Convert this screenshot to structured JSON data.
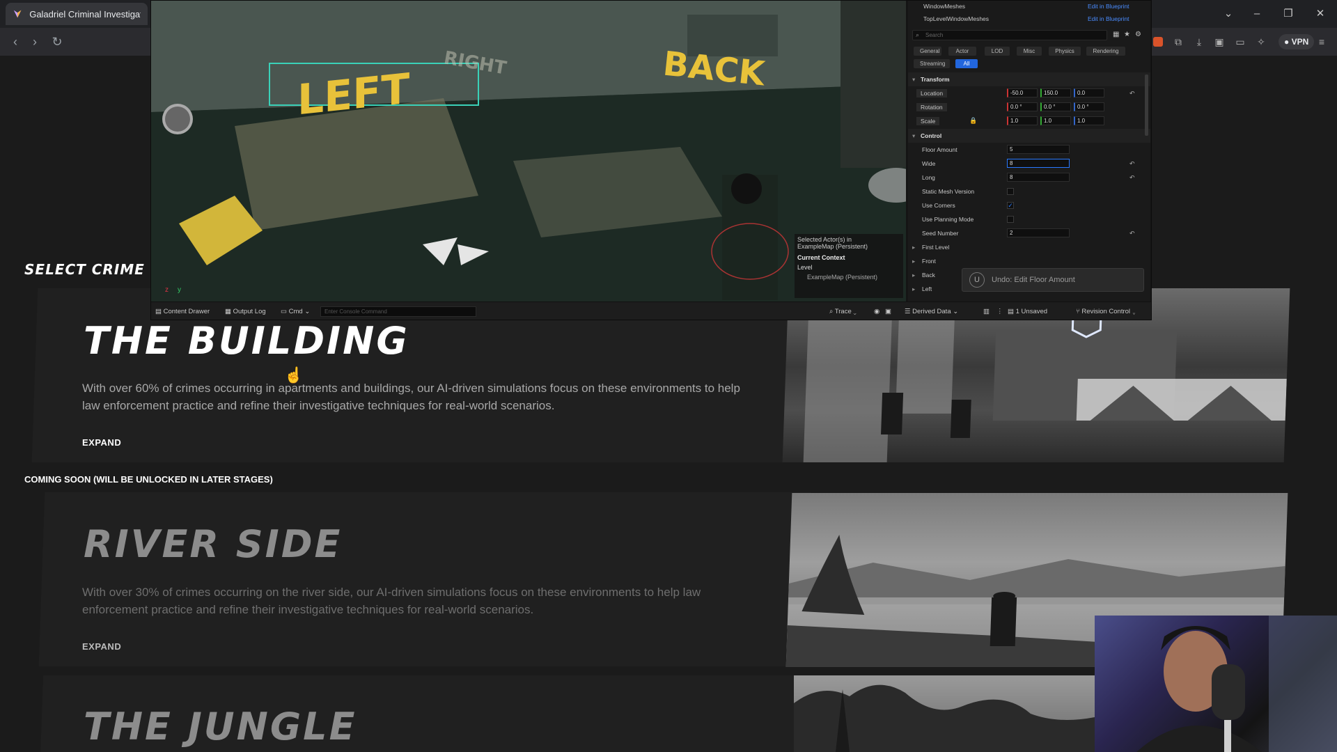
{
  "browser": {
    "tab_title": "Galadriel Criminal Investigation",
    "vpn_label": "VPN"
  },
  "editor": {
    "viewport": {
      "word_left": "LEFT",
      "word_back": "BACK",
      "word_right": "RIGHT",
      "selected_actors": "Selected Actor(s) in",
      "selected_map": "ExampleMap (Persistent)",
      "current_context": "Current Context",
      "level_label": "Level",
      "level_value": "ExampleMap (Persistent)"
    },
    "details": {
      "components": [
        {
          "name": "WindowMeshes",
          "link": "Edit in Blueprint"
        },
        {
          "name": "TopLevelWindowMeshes",
          "link": "Edit in Blueprint"
        }
      ],
      "search_placeholder": "Search",
      "filters_row1": [
        "General",
        "Actor",
        "LOD",
        "Misc",
        "Physics",
        "Rendering"
      ],
      "filters_row2": [
        "Streaming",
        "All"
      ],
      "transform_label": "Transform",
      "location": {
        "label": "Location",
        "x": "-50.0",
        "y": "150.0",
        "z": "0.0"
      },
      "rotation": {
        "label": "Rotation",
        "x": "0.0 °",
        "y": "0.0 °",
        "z": "0.0 °"
      },
      "scale": {
        "label": "Scale",
        "x": "1.0",
        "y": "1.0",
        "z": "1.0"
      },
      "control_label": "Control",
      "floor_amount": {
        "label": "Floor Amount",
        "value": "5"
      },
      "wide": {
        "label": "Wide",
        "value": "8"
      },
      "long": {
        "label": "Long",
        "value": "8"
      },
      "static_mesh_version": {
        "label": "Static Mesh Version",
        "checked": false
      },
      "use_corners": {
        "label": "Use Corners",
        "checked": true
      },
      "use_planning_mode": {
        "label": "Use Planning Mode",
        "checked": false
      },
      "seed_number": {
        "label": "Seed Number",
        "value": "2"
      },
      "sections": [
        "First Level",
        "Front",
        "Back",
        "Left"
      ]
    },
    "undo_toast": "Undo: Edit Floor Amount",
    "statusbar": {
      "content_drawer": "Content Drawer",
      "output_log": "Output Log",
      "cmd": "Cmd",
      "console_placeholder": "Enter Console Command",
      "trace": "Trace",
      "derived_data": "Derived Data",
      "unsaved": "1 Unsaved",
      "revision_control": "Revision Control"
    }
  },
  "page": {
    "select_heading": "SELECT CRIME SCEN",
    "building": {
      "title": "THE BUILDING",
      "description": "With over 60% of crimes occurring in apartments and buildings, our AI-driven simulations focus on these environments to help law enforcement practice and refine their investigative techniques for real-world scenarios.",
      "expand": "EXPAND"
    },
    "coming_soon": "COMING SOON (WILL BE UNLOCKED IN LATER STAGES)",
    "river": {
      "title": "RIVER SIDE",
      "description": "With over 30% of crimes occurring on the river side, our AI-driven simulations focus on these environments to help law enforcement practice and refine their investigative techniques for real-world scenarios.",
      "expand": "EXPAND"
    },
    "jungle": {
      "title": "THE JUNGLE"
    }
  }
}
